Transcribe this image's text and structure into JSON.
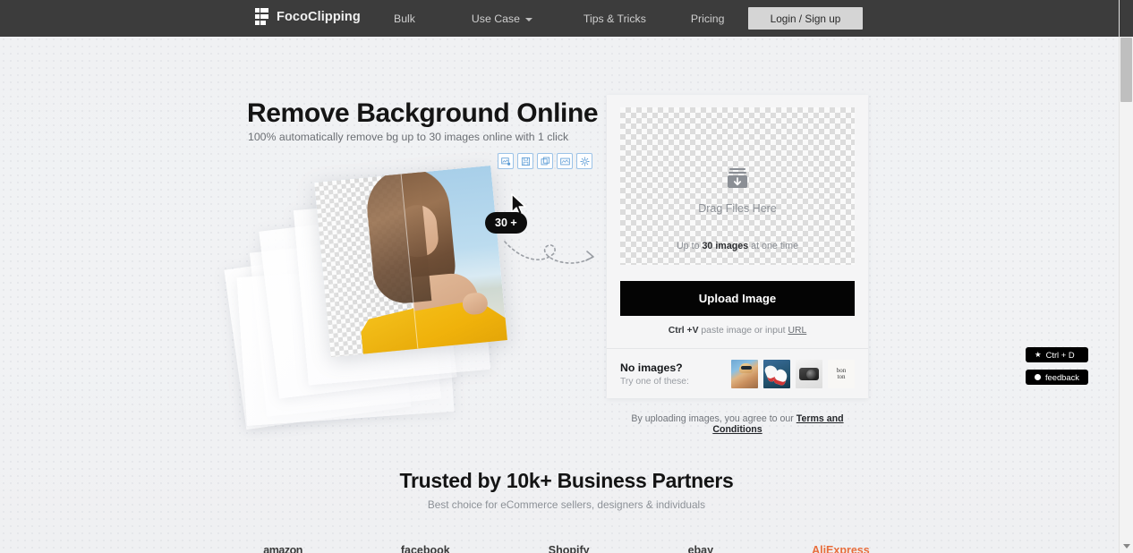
{
  "header": {
    "brand": "FocoClipping",
    "logo_icon": "foco-blocks-logo-icon",
    "nav": [
      {
        "label": "Bulk",
        "has_caret": false
      },
      {
        "label": "Use Case",
        "has_caret": true
      },
      {
        "label": "Tips & Tricks",
        "has_caret": false
      },
      {
        "label": "Pricing",
        "has_caret": false
      }
    ],
    "login_label": "Login / Sign up",
    "bg_color": "#3c3c3c"
  },
  "hero": {
    "title": "Remove Background Online",
    "subtitle": "100% automatically remove bg up to 30 images online with 1 click",
    "badge": "30 +",
    "toolbar": [
      {
        "name": "image-add-icon",
        "title": "Add image"
      },
      {
        "name": "save-icon",
        "title": "Save"
      },
      {
        "name": "duplicate-icon",
        "title": "Duplicate"
      },
      {
        "name": "image-edit-icon",
        "title": "Edit image"
      },
      {
        "name": "settings-gear-icon",
        "title": "Settings"
      }
    ],
    "accent_color": "#5b9bd5"
  },
  "upload": {
    "drop_label": "Drag Files Here",
    "drop_icon": "download-tray-icon",
    "limit_prefix": "Up to ",
    "limit_strong": "30 images",
    "limit_suffix": " at one time",
    "button_label": "Upload Image",
    "button_color": "#040404",
    "paste_strong": "Ctrl +V",
    "paste_text": " paste image or input ",
    "paste_link": "URL",
    "samples_title": "No images?",
    "samples_subtitle": "Try one of these:",
    "samples": [
      {
        "name": "sample-woman-sunglasses",
        "alt": "Woman with sunglasses"
      },
      {
        "name": "sample-white-sneakers",
        "alt": "White sneakers"
      },
      {
        "name": "sample-camera",
        "alt": "Black camera"
      },
      {
        "name": "sample-bonton-logo",
        "alt": "bon ton",
        "text_line1": "bon",
        "text_line2": "ton"
      }
    ],
    "terms_text": "By uploading images, you agree to our ",
    "terms_link": "Terms and Conditions"
  },
  "trusted": {
    "title": "Trusted by 10k+ Business Partners",
    "subtitle": "Best choice for eCommerce sellers, designers & individuals",
    "partners": [
      {
        "label": "amazon"
      },
      {
        "label": "facebook"
      },
      {
        "label": "Shopify"
      },
      {
        "label": "ebay"
      },
      {
        "label": "AliExpress"
      }
    ]
  },
  "side_widgets": [
    {
      "icon": "star-icon",
      "label": "Ctrl + D"
    },
    {
      "icon": "dot-icon",
      "label": "feedback"
    }
  ],
  "scrollbar": {
    "up_icon": "scroll-up-arrow-icon",
    "down_icon": "scroll-down-arrow-icon",
    "thumb": "scrollbar-thumb"
  }
}
